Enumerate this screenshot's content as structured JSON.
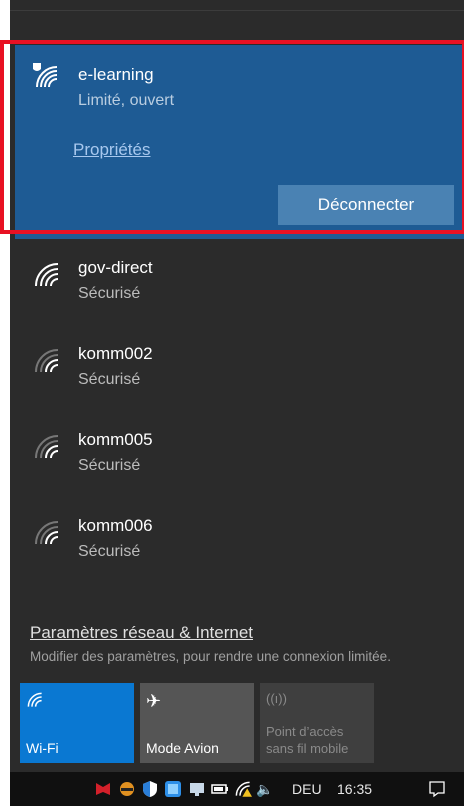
{
  "connected_network": {
    "name": "e-learning",
    "status": "Limité, ouvert",
    "properties_link": "Propriétés",
    "disconnect_label": "Déconnecter"
  },
  "networks": [
    {
      "name": "gov-direct",
      "status": "Sécurisé"
    },
    {
      "name": "komm002",
      "status": "Sécurisé"
    },
    {
      "name": "komm005",
      "status": "Sécurisé"
    },
    {
      "name": "komm006",
      "status": "Sécurisé"
    }
  ],
  "settings": {
    "link": "Paramètres réseau & Internet",
    "description": "Modifier des paramètres, pour rendre une connexion limitée."
  },
  "tiles": {
    "wifi": "Wi-Fi",
    "airplane": "Mode Avion",
    "hotspot": "Point d’accès sans fil mobile"
  },
  "taskbar": {
    "language": "DEU",
    "time": "16:35"
  },
  "colors": {
    "accent": "#0a78d2",
    "connected_bg": "#1e5b94",
    "highlight": "#e81123"
  }
}
